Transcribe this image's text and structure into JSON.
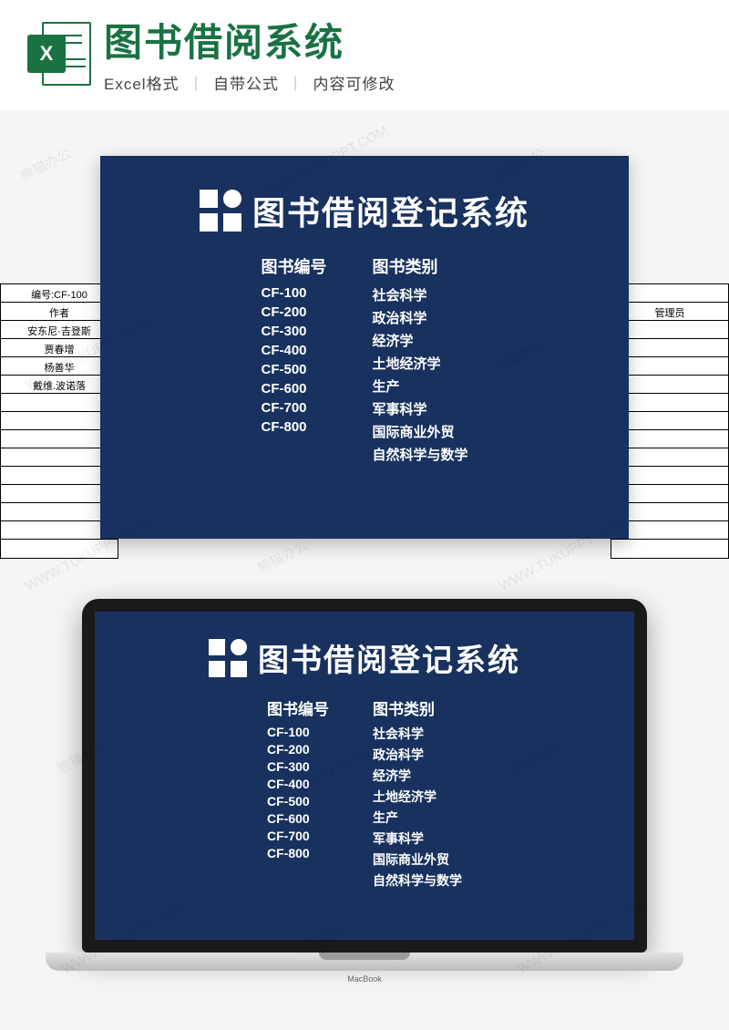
{
  "header": {
    "icon_letter": "X",
    "title": "图书借阅系统",
    "sub1": "Excel格式",
    "sub2": "自带公式",
    "sub3": "内容可修改"
  },
  "bg_left": {
    "rows": [
      "编号:CF-100",
      "作者",
      "安东尼·吉登斯",
      "贾春增",
      "杨善华",
      "戴维.波诺落",
      "",
      "",
      "",
      "",
      "",
      "",
      "",
      "",
      ""
    ]
  },
  "bg_right": {
    "rows": [
      "",
      "管理员",
      "",
      "",
      "",
      "",
      "",
      "",
      "",
      "",
      "",
      "",
      "",
      "",
      ""
    ]
  },
  "card": {
    "title": "图书借阅登记系统",
    "col1_header": "图书编号",
    "col2_header": "图书类别",
    "rows": [
      {
        "code": "CF-100",
        "cat": "社会科学"
      },
      {
        "code": "CF-200",
        "cat": "政治科学"
      },
      {
        "code": "CF-300",
        "cat": "经济学"
      },
      {
        "code": "CF-400",
        "cat": "土地经济学"
      },
      {
        "code": "CF-500",
        "cat": "生产"
      },
      {
        "code": "CF-600",
        "cat": "军事科学"
      },
      {
        "code": "CF-700",
        "cat": "国际商业外贸"
      },
      {
        "code": "CF-800",
        "cat": "自然科学与数学"
      }
    ]
  },
  "laptop": {
    "brand": "MacBook"
  },
  "watermark": {
    "text_cn": "熊猫办公",
    "text_url": "WWW.TUKUPPT.COM"
  }
}
